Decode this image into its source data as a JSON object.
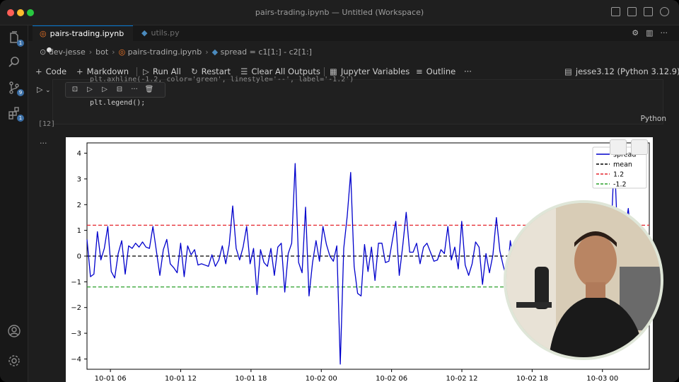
{
  "window": {
    "title": "pairs-trading.ipynb — Untitled (Workspace)"
  },
  "tabs": [
    {
      "label": "pairs-trading.ipynb",
      "active": true
    },
    {
      "label": "utils.py",
      "active": false
    }
  ],
  "activity_bar": {
    "explorer_badge": "1",
    "scm_badge": "9",
    "extensions_badge": "1"
  },
  "breadcrumb": [
    "dev-jesse",
    "bot",
    "pairs-trading.ipynb",
    "spread = c1[1:] - c2[1:]"
  ],
  "toolbar": {
    "code": "Code",
    "markdown": "Markdown",
    "run_all": "Run All",
    "restart": "Restart",
    "clear_outputs": "Clear All Outputs",
    "jupyter_variables": "Jupyter Variables",
    "outline": "Outline",
    "more": "···",
    "kernel": "jesse3.12 (Python 3.12.9)"
  },
  "cell": {
    "code_partial": "plt.axhline(-1.2, color='green', linestyle='--', label='-1.2')",
    "code_line": "plt.legend();",
    "language": "Python",
    "execution_count": "[12]",
    "output_dots": "···"
  },
  "colors": {
    "spread_line": "#0000cc",
    "mean_line": "#000000",
    "upper_line": "#e6262e",
    "lower_line": "#2ca02c",
    "accent": "#0078d4"
  },
  "chart_data": {
    "type": "line",
    "x_ticks": [
      "10-01 06",
      "10-01 12",
      "10-01 18",
      "10-02 00",
      "10-02 06",
      "10-02 12",
      "10-02 18",
      "10-03 00"
    ],
    "y_ticks": [
      "−4",
      "−3",
      "−2",
      "−1",
      "0",
      "1",
      "2",
      "3",
      "4"
    ],
    "ylim": [
      -4.4,
      4.4
    ],
    "x_start_hours": 4.0,
    "x_end_hours": 50.5,
    "legend": {
      "placement": "top-right",
      "entries": [
        "spread",
        "mean",
        "1.2",
        "-1.2"
      ]
    },
    "hlines": [
      {
        "name": "mean",
        "y": 0,
        "color": "#000000"
      },
      {
        "name": "1.2",
        "y": 1.2,
        "color": "#e6262e"
      },
      {
        "name": "-1.2",
        "y": -1.2,
        "color": "#2ca02c"
      }
    ],
    "series": [
      {
        "name": "spread",
        "values": [
          0.65,
          -0.8,
          -0.7,
          0.95,
          -0.15,
          0.3,
          1.15,
          -0.6,
          -0.85,
          0.1,
          0.6,
          -0.7,
          0.4,
          0.3,
          0.5,
          0.35,
          0.55,
          0.35,
          0.3,
          1.15,
          0.2,
          -0.75,
          0.25,
          0.65,
          -0.3,
          -0.45,
          -0.65,
          0.5,
          -0.8,
          0.4,
          0.05,
          0.25,
          -0.35,
          -0.3,
          -0.35,
          -0.4,
          0.05,
          -0.4,
          -0.15,
          0.4,
          -0.3,
          0.45,
          1.95,
          0.3,
          -0.15,
          0.35,
          1.15,
          -0.3,
          0.3,
          -1.5,
          0.25,
          -0.25,
          -0.4,
          0.3,
          -0.75,
          0.35,
          0.5,
          -1.4,
          0.1,
          0.5,
          3.6,
          -0.25,
          -0.65,
          1.9,
          -1.55,
          -0.25,
          0.6,
          -0.2,
          1.15,
          0.45,
          0.0,
          -0.2,
          0.4,
          -4.2,
          0.3,
          1.55,
          3.25,
          -0.4,
          -1.45,
          -1.55,
          0.45,
          -0.6,
          0.35,
          -0.95,
          0.5,
          0.5,
          -0.25,
          -0.2,
          0.6,
          1.35,
          -0.75,
          0.4,
          1.7,
          0.15,
          0.15,
          0.5,
          -0.3,
          0.35,
          0.5,
          0.15,
          -0.2,
          -0.15,
          0.25,
          0.1,
          1.15,
          -0.15,
          0.35,
          -0.5,
          1.35,
          -0.35,
          -0.75,
          -0.3,
          0.55,
          0.35,
          -1.1,
          0.1,
          -0.65,
          0.05,
          1.5,
          0.2,
          -0.4,
          -0.85,
          0.6,
          -0.25,
          0.15,
          0.5,
          0.4,
          0.15,
          -0.55,
          0.45,
          0.3,
          0.5,
          0.1,
          -0.15,
          0.35,
          -0.3,
          0.05,
          0.8,
          0.1,
          -0.7,
          1.1,
          -0.45,
          0.5,
          -0.15,
          -0.5,
          0.15,
          0.6,
          1.9,
          -0.75,
          0.35,
          -3.3,
          0.65,
          3.9,
          0.5,
          -0.3,
          0.9,
          1.85,
          0.35
        ]
      }
    ]
  }
}
